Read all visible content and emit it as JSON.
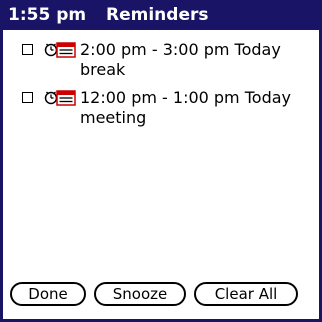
{
  "header": {
    "time": "1:55 pm",
    "title": "Reminders"
  },
  "reminders": [
    {
      "time_range": "2:00 pm - 3:00 pm Today",
      "description": "break",
      "checked": false,
      "icon": "alarm-clock-icon"
    },
    {
      "time_range": "12:00 pm - 1:00 pm Today",
      "description": "meeting",
      "checked": false,
      "icon": "alarm-clock-icon"
    }
  ],
  "buttons": {
    "done": "Done",
    "snooze": "Snooze",
    "clear_all": "Clear All"
  },
  "colors": {
    "title_bar": "#1a1466",
    "icon_red": "#cc0000"
  }
}
